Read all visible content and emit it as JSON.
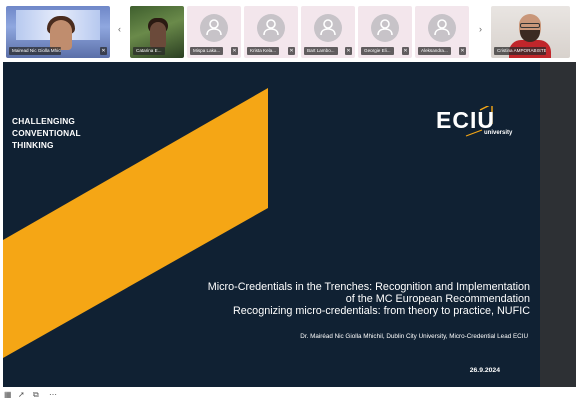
{
  "participants": [
    {
      "name": "Mairead Nic Giolla Mhichil (M..."
    },
    {
      "name": "Catarina E..."
    },
    {
      "name": "Mispa Laka..."
    },
    {
      "name": "Krista Kela..."
    },
    {
      "name": "Bart Lambo..."
    },
    {
      "name": "Georgie Eli..."
    },
    {
      "name": "Aleksandra..."
    },
    {
      "name": "Cristina AMPORABISTE..."
    }
  ],
  "strip_nav": {
    "prev_arrow": "‹",
    "next_arrow": "›"
  },
  "slide": {
    "tagline": [
      "CHALLENGING",
      "CONVENTIONAL",
      "THINKING"
    ],
    "logo": {
      "word": "ECIU",
      "sub": "university"
    },
    "title_lines": [
      "Micro-Credentials in the Trenches: Recognition and Implementation",
      "of the MC European Recommendation",
      "Recognizing micro-credentials: from theory to practice, NUFIC"
    ],
    "author": "Dr. Mairéad Nic Giolla Mhichil, Dublin City University, Micro-Credential Lead ECIU",
    "date": "26.9.2024"
  },
  "colors": {
    "slide_bg": "#102133",
    "accent_stripe": "#f5a615",
    "logo_accent": "#f5a615"
  },
  "icons": [
    "person-avatar-icon",
    "mic-muted-icon",
    "chevron-left-icon",
    "chevron-right-icon",
    "grid-icon",
    "cursor-icon",
    "copy-icon",
    "more-icon"
  ]
}
